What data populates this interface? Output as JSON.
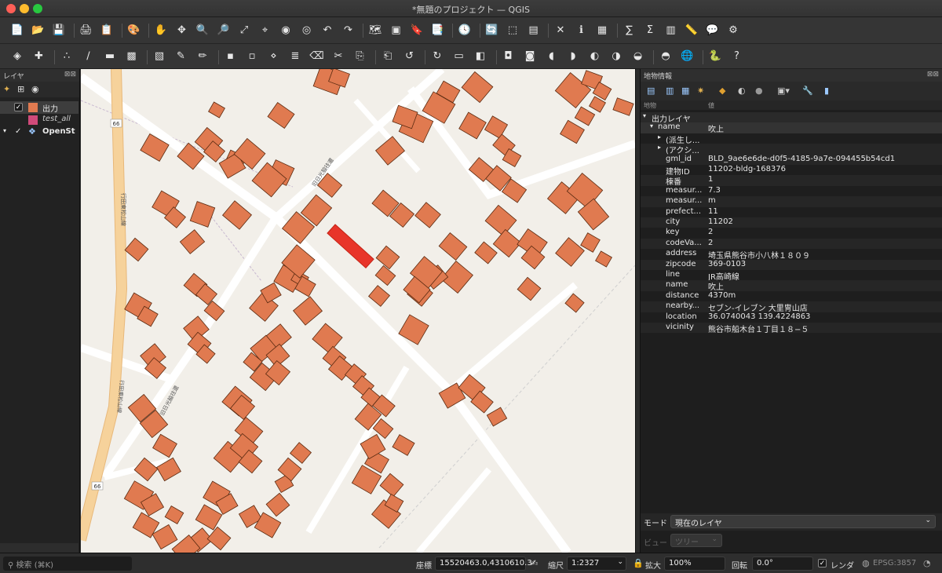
{
  "window": {
    "title": "*無題のプロジェクト — QGIS"
  },
  "colors": {
    "building": "#e07a50",
    "selected": "#e8352a",
    "road": "#ffffff",
    "major_road": "#f6d29b",
    "land": "#f2efe9"
  },
  "toolbar1": [
    {
      "name": "new-project-icon",
      "glyph": "📄"
    },
    {
      "name": "open-project-icon",
      "glyph": "📂"
    },
    {
      "name": "save-project-icon",
      "glyph": "💾"
    },
    {
      "name": "new-print-layout-icon",
      "glyph": "🖨"
    },
    {
      "name": "layout-manager-icon",
      "glyph": "📋"
    },
    {
      "name": "style-manager-icon",
      "glyph": "🎨"
    },
    {
      "name": "pan-map-icon",
      "glyph": "✋"
    },
    {
      "name": "pan-to-selection-icon",
      "glyph": "✥"
    },
    {
      "name": "zoom-in-icon",
      "glyph": "🔍"
    },
    {
      "name": "zoom-out-icon",
      "glyph": "🔎"
    },
    {
      "name": "zoom-full-icon",
      "glyph": "⤢"
    },
    {
      "name": "zoom-to-selection-icon",
      "glyph": "⌖"
    },
    {
      "name": "zoom-to-layer-icon",
      "glyph": "◉"
    },
    {
      "name": "zoom-native-icon",
      "glyph": "◎"
    },
    {
      "name": "zoom-last-icon",
      "glyph": "↶"
    },
    {
      "name": "zoom-next-icon",
      "glyph": "↷"
    },
    {
      "name": "new-map-view-icon",
      "glyph": "🗺"
    },
    {
      "name": "new-3d-view-icon",
      "glyph": "▣"
    },
    {
      "name": "new-bookmark-icon",
      "glyph": "🔖"
    },
    {
      "name": "show-bookmarks-icon",
      "glyph": "📑"
    },
    {
      "name": "temporal-controller-icon",
      "glyph": "🕓"
    },
    {
      "name": "refresh-icon",
      "glyph": "🔄"
    },
    {
      "name": "select-features-icon",
      "glyph": "⬚"
    },
    {
      "name": "select-by-value-icon",
      "glyph": "▤"
    },
    {
      "name": "deselect-icon",
      "glyph": "✕"
    },
    {
      "name": "identify-features-icon",
      "glyph": "ℹ"
    },
    {
      "name": "attribute-table-icon",
      "glyph": "▦"
    },
    {
      "name": "field-calculator-icon",
      "glyph": "∑"
    },
    {
      "name": "statistics-icon",
      "glyph": "Σ"
    },
    {
      "name": "open-table-icon",
      "glyph": "▥"
    },
    {
      "name": "measure-icon",
      "glyph": "📏"
    },
    {
      "name": "map-tips-icon",
      "glyph": "💬"
    },
    {
      "name": "processing-icon",
      "glyph": "⚙"
    }
  ],
  "toolbar2": [
    {
      "name": "data-source-manager-icon",
      "glyph": "◈"
    },
    {
      "name": "add-layer-icon",
      "glyph": "✚"
    },
    {
      "name": "digitize-point-icon",
      "glyph": "∴"
    },
    {
      "name": "digitize-line-icon",
      "glyph": "∕"
    },
    {
      "name": "digitize-polygon-icon",
      "glyph": "▬"
    },
    {
      "name": "new-geopackage-icon",
      "glyph": "▩"
    },
    {
      "name": "new-temp-layer-icon",
      "glyph": "▧"
    },
    {
      "name": "edit-pencil-icon",
      "glyph": "✎"
    },
    {
      "name": "toggle-editing-icon",
      "glyph": "✏"
    },
    {
      "name": "save-edits-icon",
      "glyph": "▪"
    },
    {
      "name": "add-feature-icon",
      "glyph": "▫"
    },
    {
      "name": "vertex-tool-icon",
      "glyph": "⋄"
    },
    {
      "name": "modify-attributes-icon",
      "glyph": "≣"
    },
    {
      "name": "delete-selected-icon",
      "glyph": "⌫"
    },
    {
      "name": "cut-icon",
      "glyph": "✂"
    },
    {
      "name": "copy-icon",
      "glyph": "⎘"
    },
    {
      "name": "paste-icon",
      "glyph": "⎗"
    },
    {
      "name": "undo-icon",
      "glyph": "↺"
    },
    {
      "name": "redo-icon",
      "glyph": "↻"
    },
    {
      "name": "label-tool-icon",
      "glyph": "▭"
    },
    {
      "name": "label-style-icon",
      "glyph": "◧"
    },
    {
      "name": "pin-label-icon",
      "glyph": "◘"
    },
    {
      "name": "highlight-label-icon",
      "glyph": "◙"
    },
    {
      "name": "move-label-icon",
      "glyph": "◖"
    },
    {
      "name": "rotate-label-icon",
      "glyph": "◗"
    },
    {
      "name": "change-label-icon",
      "glyph": "◐"
    },
    {
      "name": "show-hide-labels-icon",
      "glyph": "◑"
    },
    {
      "name": "label-options-icon",
      "glyph": "◒"
    },
    {
      "name": "label-move-icon",
      "glyph": "◓"
    },
    {
      "name": "metasearch-icon",
      "glyph": "🌐"
    },
    {
      "name": "python-console-icon",
      "glyph": "🐍"
    },
    {
      "name": "help-icon",
      "glyph": "?"
    }
  ],
  "layers": {
    "title": "レイヤ",
    "items": [
      {
        "name": "出力",
        "checked": true,
        "color": "#e07a50"
      },
      {
        "name": "test_all",
        "checked": false,
        "color": "#d04a7a"
      },
      {
        "name": "OpenSt",
        "checked": true,
        "color": "#4aa3d8"
      }
    ]
  },
  "map_labels": {
    "road_66_a": "66",
    "road_66_b": "66",
    "route_label_1": "行田東松山線",
    "route_label_2": "行田東松山線",
    "street_label_1": "旧日光脇往還",
    "street_label_2": "旧日光脇往還"
  },
  "identify": {
    "title": "地物情報",
    "col_feature": "地物",
    "col_value": "値",
    "layer_group": "出力レイヤ",
    "feature_key": "name",
    "feature_value": "吹上",
    "derived_label": "(派生し...",
    "actions_label": "(アクシ...",
    "attributes": [
      {
        "k": "gml_id",
        "v": "BLD_9ae6e6de-d0f5-4185-9a7e-094455b54cd1"
      },
      {
        "k": "建物ID",
        "v": "11202-bldg-168376"
      },
      {
        "k": "棟番",
        "v": "1"
      },
      {
        "k": "measur...",
        "v": "7.3"
      },
      {
        "k": "measur...",
        "v": "m"
      },
      {
        "k": "prefect...",
        "v": "11"
      },
      {
        "k": "city",
        "v": "11202"
      },
      {
        "k": "key",
        "v": "2"
      },
      {
        "k": "codeVa...",
        "v": "2"
      },
      {
        "k": "address",
        "v": "埼玉県熊谷市小八林１８０９"
      },
      {
        "k": "zipcode",
        "v": "369-0103"
      },
      {
        "k": "line",
        "v": "JR高崎線"
      },
      {
        "k": "name",
        "v": "吹上"
      },
      {
        "k": "distance",
        "v": "4370m"
      },
      {
        "k": "nearby...",
        "v": "セブン-イレブン 大里冑山店"
      },
      {
        "k": "location",
        "v": "36.0740043 139.4224863"
      },
      {
        "k": "vicinity",
        "v": "熊谷市船木台１丁目１８−５"
      }
    ],
    "mode_label": "モード",
    "mode_value": "現在のレイヤ",
    "view_label": "ビュー",
    "view_value": "ツリー"
  },
  "status": {
    "search_placeholder": "検索 (⌘K)",
    "coord_label": "座標",
    "coord_value": "15520463.0,4310610.3",
    "scale_label": "縮尺",
    "scale_value": "1:2327",
    "magnify_label": "拡大",
    "magnify_value": "100%",
    "rotation_label": "回転",
    "rotation_value": "0.0°",
    "render_label": "レンダ",
    "crs_value": "EPSG:3857"
  }
}
